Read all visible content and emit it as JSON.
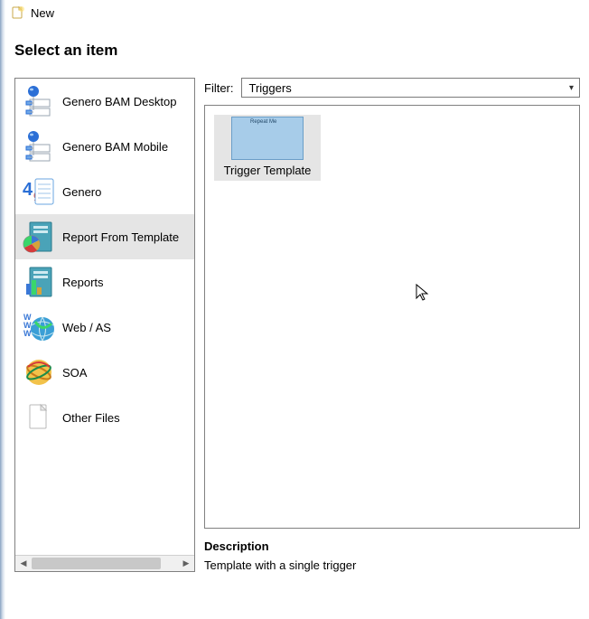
{
  "window": {
    "title": "New"
  },
  "heading": "Select an item",
  "categories": [
    {
      "id": "bam-desktop",
      "label": "Genero BAM Desktop",
      "selected": false
    },
    {
      "id": "bam-mobile",
      "label": "Genero BAM Mobile",
      "selected": false
    },
    {
      "id": "genero",
      "label": "Genero",
      "selected": false
    },
    {
      "id": "report-tpl",
      "label": "Report From Template",
      "selected": true
    },
    {
      "id": "reports",
      "label": "Reports",
      "selected": false
    },
    {
      "id": "web-as",
      "label": "Web / AS",
      "selected": false
    },
    {
      "id": "soa",
      "label": "SOA",
      "selected": false
    },
    {
      "id": "other",
      "label": "Other Files",
      "selected": false
    }
  ],
  "filter": {
    "label": "Filter:",
    "value": "Triggers"
  },
  "items": [
    {
      "id": "trigger-tpl",
      "label": "Trigger Template",
      "hint": "Repeat Me",
      "selected": true
    }
  ],
  "description": {
    "title": "Description",
    "text": "Template with a single trigger"
  }
}
